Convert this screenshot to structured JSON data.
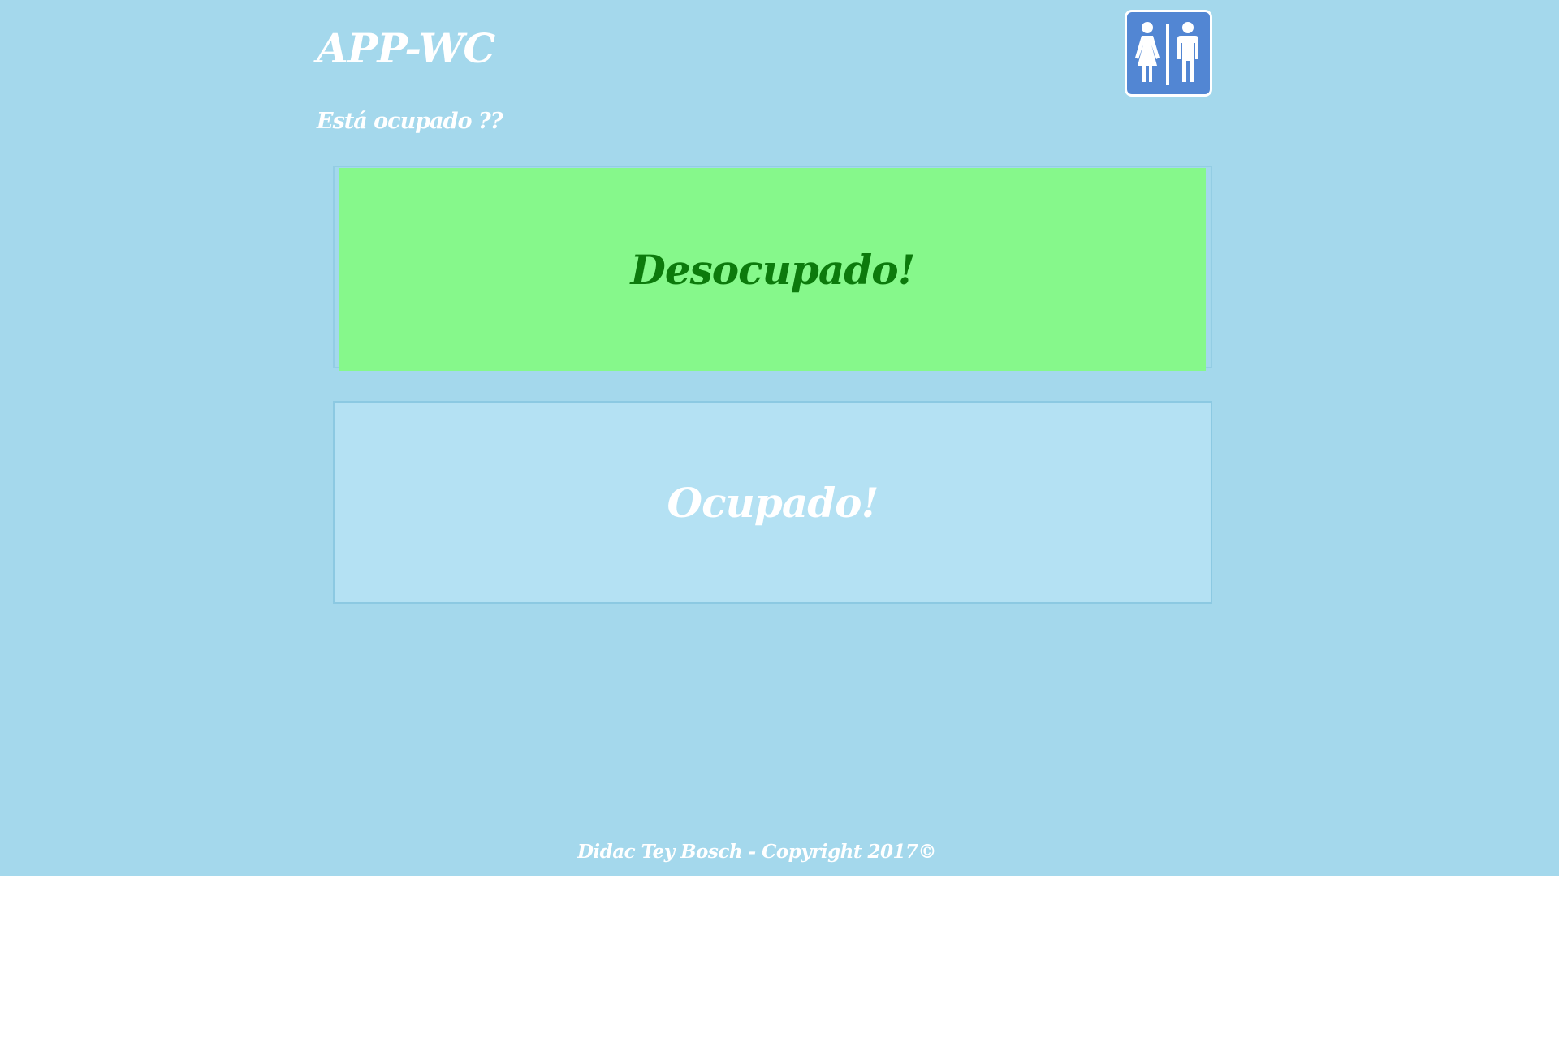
{
  "header": {
    "title": "APP-WC",
    "subtitle": "Está ocupado ??",
    "logo_icon": "restroom-sign-icon"
  },
  "status": {
    "free_label": "Desocupado!",
    "busy_label": "Ocupado!"
  },
  "footer": {
    "text": "Didac Tey Bosch - Copyright 2017©"
  },
  "colors": {
    "background": "#a4d8ec",
    "free": "#86f88b",
    "free_text": "#0c7a0c",
    "busy": "#b4e1f3",
    "logo": "#5286d3"
  }
}
